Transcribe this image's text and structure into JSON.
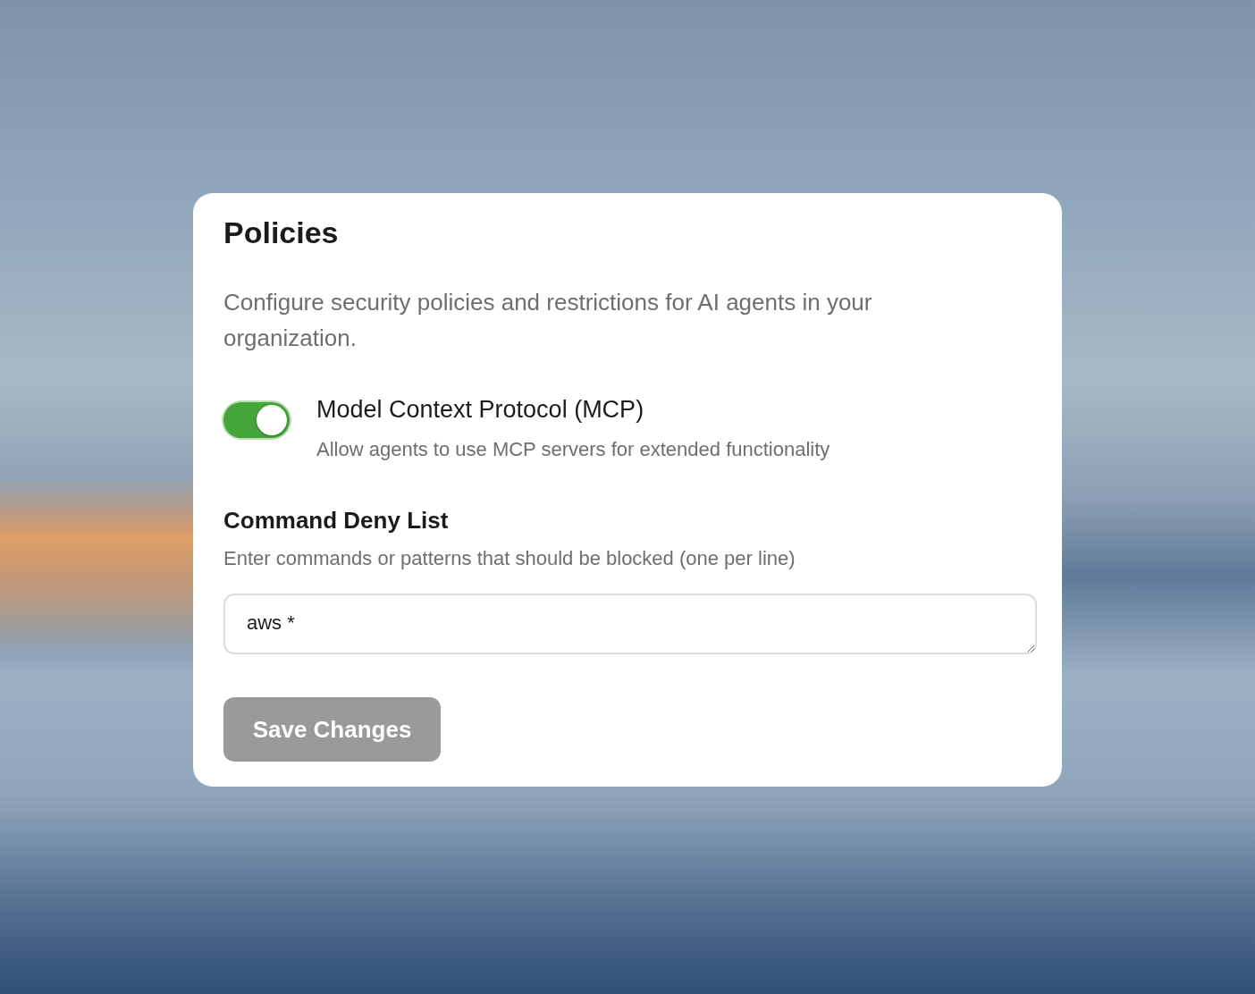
{
  "panel": {
    "title": "Policies",
    "description": "Configure security policies and restrictions for AI agents in your organization."
  },
  "mcp": {
    "label": "Model Context Protocol (MCP)",
    "description": "Allow agents to use MCP servers for extended functionality",
    "on": true
  },
  "deny_list": {
    "label": "Command Deny List",
    "hint": "Enter commands or patterns that should be blocked (one per line)",
    "value": "aws *"
  },
  "save_button": {
    "label": "Save Changes",
    "disabled": true
  }
}
